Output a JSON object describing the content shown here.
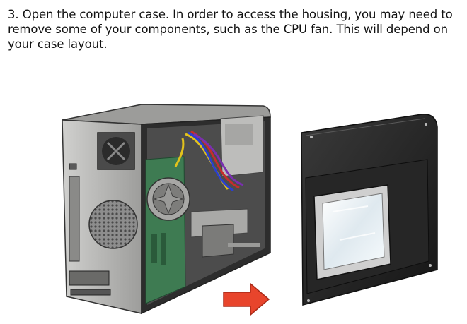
{
  "step": {
    "text": "3. Open the computer case. In order to access the housing, you may need to remove some of your components, such as the CPU fan. This will depend on your case layout."
  },
  "illustration": {
    "subjects": [
      "computer-case",
      "case-side-panel",
      "direction-arrow"
    ],
    "colors": {
      "case_body": "#b9b9b7",
      "case_dark": "#2b2b2b",
      "panel_dark": "#1f1f1f",
      "motherboard": "#3e7b52",
      "arrow": "#e8452c",
      "window_glass": "#e9f1f6"
    }
  }
}
